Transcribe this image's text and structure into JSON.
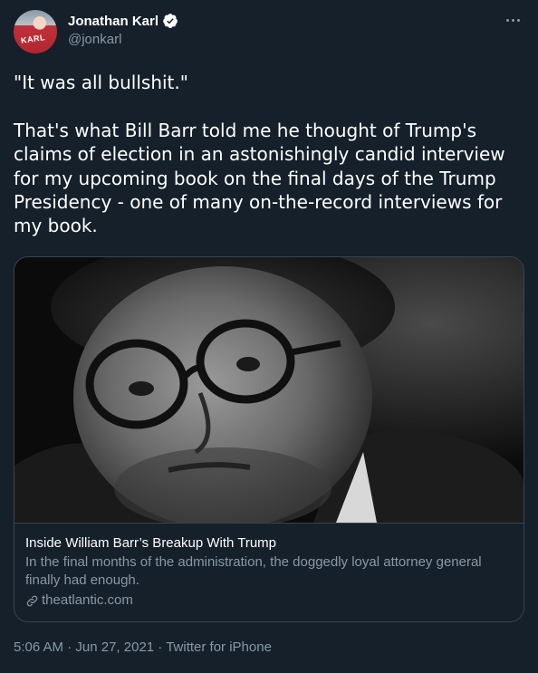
{
  "author": {
    "display_name": "Jonathan Karl",
    "handle": "@jonkarl",
    "avatar_icon": "profile-photo",
    "avatar_jersey_text": "KARL",
    "verified_icon": "verified-badge-icon",
    "verified_color": "#ffffff"
  },
  "more_icon": "ellipsis-icon",
  "tweet": {
    "text": "\"It was all bullshit.\"\n\nThat's what Bill Barr told me he thought of Trump's claims of election in an astonishingly candid interview for my upcoming book on the final days of the Trump Presidency - one of many on-the-record interviews for my book."
  },
  "card": {
    "image_alt_icon": "portrait-photo",
    "title": "Inside William Barr’s Breakup With Trump",
    "description": "In the final months of the administration, the doggedly loyal attorney general finally had enough.",
    "domain": "theatlantic.com",
    "domain_icon": "link-icon"
  },
  "meta": {
    "time": "5:06 AM",
    "separator": " · ",
    "date": "Jun 27, 2021",
    "source": "Twitter for iPhone"
  },
  "colors": {
    "background": "#15202b",
    "secondary_text": "#8899a6",
    "border": "#38444d",
    "primary_text": "#ffffff"
  }
}
